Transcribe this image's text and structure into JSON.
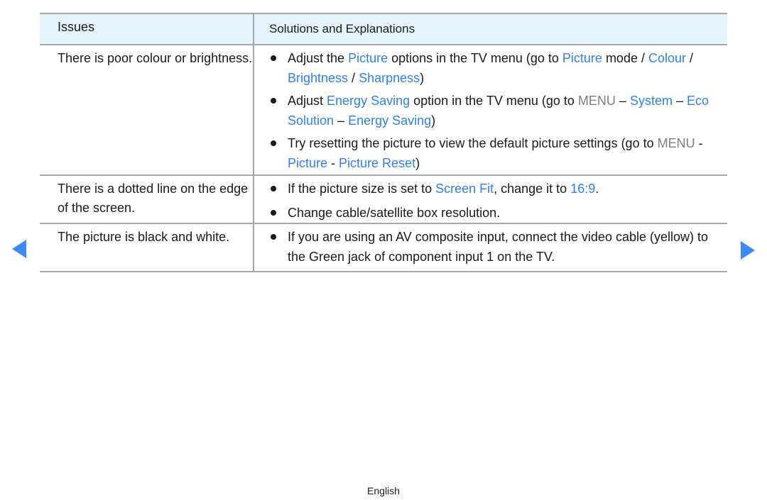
{
  "table": {
    "headers": {
      "issues": "Issues",
      "solutions": "Solutions and Explanations"
    },
    "rows": [
      {
        "issue": "There is poor colour or brightness.",
        "solutions": [
          [
            {
              "t": "Adjust the ",
              "s": "plain"
            },
            {
              "t": "Picture",
              "s": "hl"
            },
            {
              "t": " options in the TV menu (go to ",
              "s": "plain"
            },
            {
              "t": "Picture",
              "s": "hl"
            },
            {
              "t": " mode / ",
              "s": "plain"
            },
            {
              "t": "Colour",
              "s": "hl"
            },
            {
              "t": " / ",
              "s": "plain"
            },
            {
              "t": "Brightness",
              "s": "hl"
            },
            {
              "t": " / ",
              "s": "plain"
            },
            {
              "t": "Sharpness",
              "s": "hl"
            },
            {
              "t": ")",
              "s": "plain"
            }
          ],
          [
            {
              "t": "Adjust ",
              "s": "plain"
            },
            {
              "t": "Energy Saving",
              "s": "hl"
            },
            {
              "t": " option in the TV menu (go to ",
              "s": "plain"
            },
            {
              "t": "MENU",
              "s": "menu"
            },
            {
              "t": " – ",
              "s": "plain"
            },
            {
              "t": "System",
              "s": "hl"
            },
            {
              "t": " – ",
              "s": "plain"
            },
            {
              "t": "Eco Solution",
              "s": "hl"
            },
            {
              "t": " – ",
              "s": "plain"
            },
            {
              "t": "Energy Saving",
              "s": "hl"
            },
            {
              "t": ")",
              "s": "plain"
            }
          ],
          [
            {
              "t": "Try resetting the picture to view the default picture settings (go to ",
              "s": "plain"
            },
            {
              "t": "MENU",
              "s": "menu"
            },
            {
              "t": " - ",
              "s": "plain"
            },
            {
              "t": "Picture",
              "s": "hl"
            },
            {
              "t": " - ",
              "s": "plain"
            },
            {
              "t": "Picture Reset",
              "s": "hl"
            },
            {
              "t": ")",
              "s": "plain"
            }
          ]
        ]
      },
      {
        "issue": "There is a dotted line on the edge of the screen.",
        "solutions": [
          [
            {
              "t": "If the picture size is set to ",
              "s": "plain"
            },
            {
              "t": "Screen Fit",
              "s": "hl"
            },
            {
              "t": ", change it to ",
              "s": "plain"
            },
            {
              "t": "16:9",
              "s": "hl"
            },
            {
              "t": ".",
              "s": "plain"
            }
          ],
          [
            {
              "t": "Change cable/satellite box resolution.",
              "s": "plain"
            }
          ]
        ]
      },
      {
        "issue": "The picture is black and white.",
        "solutions": [
          [
            {
              "t": "If you are using an AV composite input, connect the video cable (yellow) to the Green jack of component input 1 on the TV.",
              "s": "plain"
            }
          ]
        ]
      }
    ]
  },
  "navigation": {
    "prev_icon": "triangle-left-icon",
    "next_icon": "triangle-right-icon"
  },
  "footer": {
    "language": "English"
  },
  "colors": {
    "accent": "#2f80ee",
    "menu_gray": "#7f7f7f",
    "header_bg": "#e5f5fc",
    "arrow": "#3d8af7",
    "rule": "#a7a7a7"
  }
}
